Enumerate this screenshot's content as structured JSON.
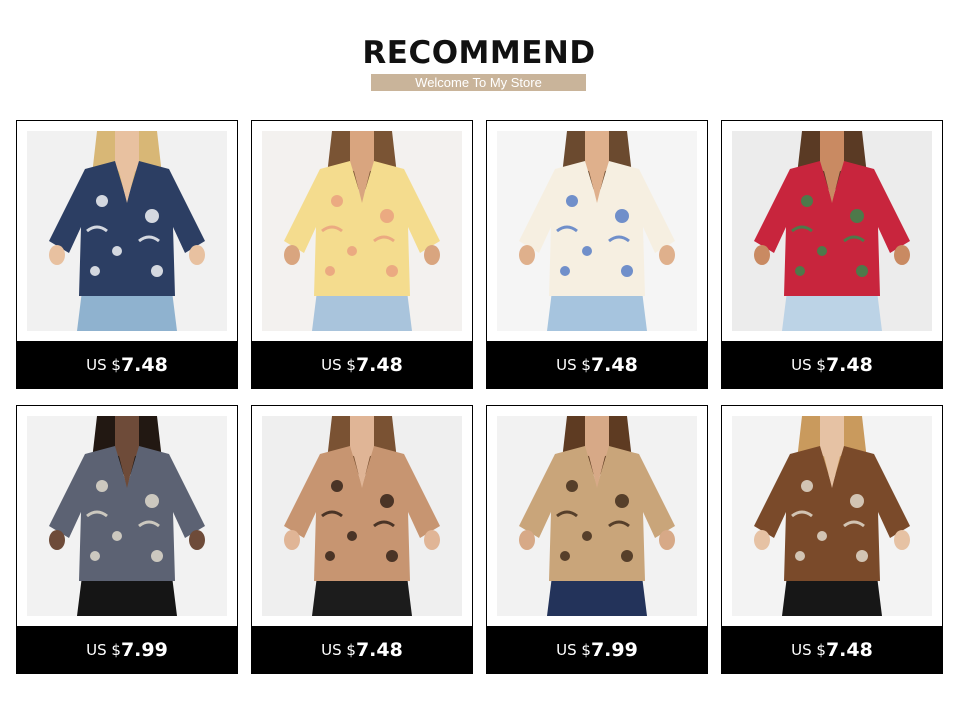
{
  "header": {
    "title": "RECOMMEND",
    "subtitle": "Welcome To My Store"
  },
  "colors": {
    "subtitle_bar": "#c9b49a",
    "price_bar": "#000000",
    "card_border": "#000000"
  },
  "products": [
    {
      "image": "navy-tropical-print-shirt",
      "currency": "US $",
      "price": "7.48",
      "bg": "#f1f1f1",
      "shirt": "#2c3e63",
      "accent": "#ffffff",
      "pants": "#8fb2cf",
      "skin": "#e8c1a0",
      "hair": "#d8b776"
    },
    {
      "image": "yellow-palm-print-shirt",
      "currency": "US $",
      "price": "7.48",
      "bg": "#f3f1ef",
      "shirt": "#f4dc8e",
      "accent": "#e89e7e",
      "pants": "#a9c4dc",
      "skin": "#d9a57f",
      "hair": "#7a5434"
    },
    {
      "image": "chain-print-white-shirt",
      "currency": "US $",
      "price": "7.48",
      "bg": "#f5f5f5",
      "shirt": "#f6efe1",
      "accent": "#4f77c4",
      "pants": "#a6c4de",
      "skin": "#dfb08c",
      "hair": "#6b4a2f"
    },
    {
      "image": "rainbow-stripe-shirt",
      "currency": "US $",
      "price": "7.48",
      "bg": "#ececec",
      "shirt": "#c8253d",
      "accent": "#2f8f4e",
      "pants": "#bcd3e6",
      "skin": "#c98a62",
      "hair": "#5a3a24"
    },
    {
      "image": "mixed-animal-print-shirt",
      "currency": "US $",
      "price": "7.99",
      "bg": "#f2f2f2",
      "shirt": "#5c6273",
      "accent": "#e8e2d2",
      "pants": "#151515",
      "skin": "#6e4b39",
      "hair": "#221812"
    },
    {
      "image": "zebra-print-shirt",
      "currency": "US $",
      "price": "7.48",
      "bg": "#efefef",
      "shirt": "#c79571",
      "accent": "#2a1c14",
      "pants": "#1c1c1c",
      "skin": "#e0b596",
      "hair": "#7a5233"
    },
    {
      "image": "leopard-print-shirt",
      "currency": "US $",
      "price": "7.99",
      "bg": "#f2f2f2",
      "shirt": "#c9a57a",
      "accent": "#3a2617",
      "pants": "#23335a",
      "skin": "#d7a987",
      "hair": "#5e3b22"
    },
    {
      "image": "patchwork-animal-print-shirt",
      "currency": "US $",
      "price": "7.48",
      "bg": "#f3f3f3",
      "shirt": "#7a4a2a",
      "accent": "#e9e2d6",
      "pants": "#171717",
      "skin": "#e6c2a4",
      "hair": "#c99a5d"
    }
  ]
}
